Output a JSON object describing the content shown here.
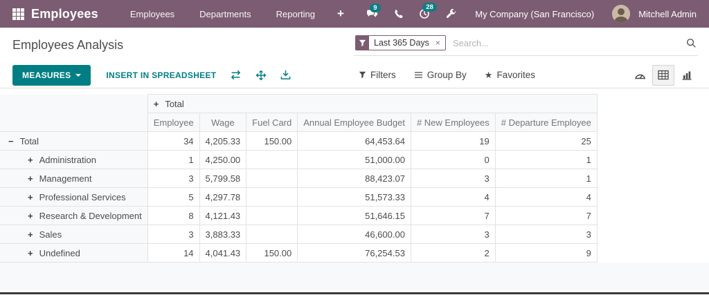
{
  "nav": {
    "app_title": "Employees",
    "menus": [
      "Employees",
      "Departments",
      "Reporting"
    ],
    "messages_badge": "9",
    "activities_badge": "28",
    "company": "My Company (San Francisco)",
    "user": "Mitchell Admin"
  },
  "control_panel": {
    "title": "Employees Analysis",
    "search": {
      "facet": "Last 365 Days",
      "placeholder": "Search..."
    }
  },
  "toolbar": {
    "measures_label": "MEASURES",
    "insert_label": "INSERT IN SPREADSHEET",
    "filters_label": "Filters",
    "groupby_label": "Group By",
    "favorites_label": "Favorites"
  },
  "icons": {
    "plus": "+",
    "minus": "−",
    "close": "×",
    "star": "★"
  },
  "pivot": {
    "col_group_header": "Total",
    "columns": [
      "Employee",
      "Wage",
      "Fuel Card",
      "Annual Employee Budget",
      "# New Employees",
      "# Departure Employee"
    ],
    "rows": [
      {
        "label": "Total",
        "level": 0,
        "expanded": true,
        "values": [
          "34",
          "4,205.33",
          "150.00",
          "64,453.64",
          "19",
          "25"
        ]
      },
      {
        "label": "Administration",
        "level": 1,
        "expanded": false,
        "values": [
          "1",
          "4,250.00",
          "",
          "51,000.00",
          "0",
          "1"
        ]
      },
      {
        "label": "Management",
        "level": 1,
        "expanded": false,
        "values": [
          "3",
          "5,799.58",
          "",
          "88,423.07",
          "3",
          "1"
        ]
      },
      {
        "label": "Professional Services",
        "level": 1,
        "expanded": false,
        "values": [
          "5",
          "4,297.78",
          "",
          "51,573.33",
          "4",
          "4"
        ]
      },
      {
        "label": "Research & Development",
        "level": 1,
        "expanded": false,
        "values": [
          "8",
          "4,121.43",
          "",
          "51,646.15",
          "7",
          "7"
        ]
      },
      {
        "label": "Sales",
        "level": 1,
        "expanded": false,
        "values": [
          "3",
          "3,883.33",
          "",
          "46,600.00",
          "3",
          "3"
        ]
      },
      {
        "label": "Undefined",
        "level": 1,
        "expanded": false,
        "values": [
          "14",
          "4,041.43",
          "150.00",
          "76,254.53",
          "2",
          "9"
        ]
      }
    ]
  },
  "colors": {
    "nav_bg": "#7c5c72",
    "accent_teal": "#017e84",
    "badge_teal": "#0e7d83",
    "header_cell_bg": "#f8f9fa",
    "border": "#e2e2e2"
  }
}
